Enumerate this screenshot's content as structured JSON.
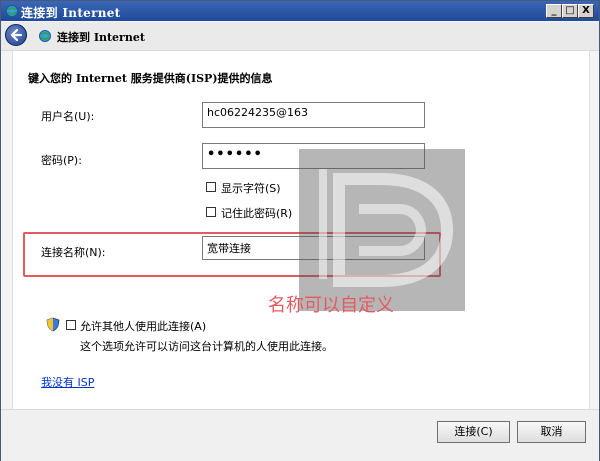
{
  "window": {
    "title": "连接到 Internet",
    "min_btn": "_",
    "max_btn": "□",
    "close_btn": "X"
  },
  "nav": {
    "title": "连接到 Internet"
  },
  "form": {
    "heading": "键入您的 Internet 服务提供商(ISP)提供的信息",
    "username_label": "用户名(U):",
    "username_value": "hc06224235@163",
    "password_label": "密码(P):",
    "password_mask": "••••••",
    "show_chars_label": "显示字符(S)",
    "remember_label": "记住此密码(R)",
    "connname_label": "连接名称(N):",
    "connname_value": "宽带连接"
  },
  "annotation": {
    "text": "名称可以自定义",
    "color": "#e35a60"
  },
  "share": {
    "allow_label": "允许其他人使用此连接(A)",
    "allow_desc": "这个选项允许可以访问这台计算机的人使用此连接。"
  },
  "links": {
    "no_isp": "我没有 ISP"
  },
  "footer": {
    "connect_label": "连接(C)",
    "cancel_label": "取消"
  },
  "icons": {
    "title_icon": "network-globe-icon",
    "back": "back-arrow-icon",
    "shield": "uac-shield-icon"
  }
}
